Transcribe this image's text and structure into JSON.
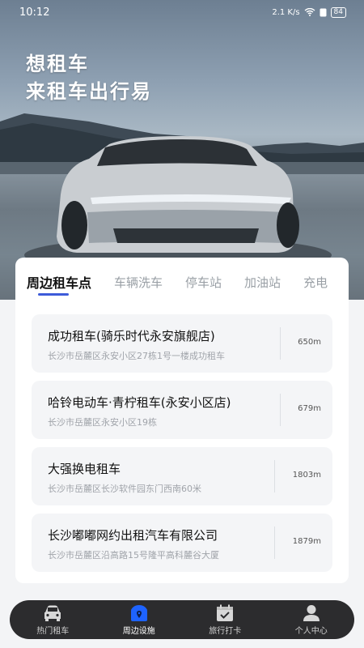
{
  "status": {
    "time": "10:12",
    "network": "2.1 K/s",
    "battery": "84"
  },
  "hero": {
    "line1": "想租车",
    "line2": "来租车出行易"
  },
  "tabs": [
    "周边租车点",
    "车辆洗车",
    "停车站",
    "加油站",
    "充电"
  ],
  "places": [
    {
      "name": "成功租车(骑乐时代永安旗舰店)",
      "address": "长沙市岳麓区永安小区27栋1号一楼成功租车",
      "distance": "650m"
    },
    {
      "name": "哈铃电动车·青柠租车(永安小区店)",
      "address": "长沙市岳麓区永安小区19栋",
      "distance": "679m"
    },
    {
      "name": "大强换电租车",
      "address": "长沙市岳麓区长沙软件园东门西南60米",
      "distance": "1803m"
    },
    {
      "name": "长沙嘟嘟网约出租汽车有限公司",
      "address": "长沙市岳麓区沿高路15号隆平高科麓谷大厦",
      "distance": "1879m"
    }
  ],
  "nav": [
    {
      "label": "热门租车",
      "icon": "car-icon"
    },
    {
      "label": "周边设施",
      "icon": "map-pin-icon"
    },
    {
      "label": "旅行打卡",
      "icon": "calendar-check-icon"
    },
    {
      "label": "个人中心",
      "icon": "user-icon"
    }
  ],
  "colors": {
    "accent": "#3d5bd9",
    "nav_bg": "#2c2c2e",
    "active_icon": "#1e63ff"
  }
}
